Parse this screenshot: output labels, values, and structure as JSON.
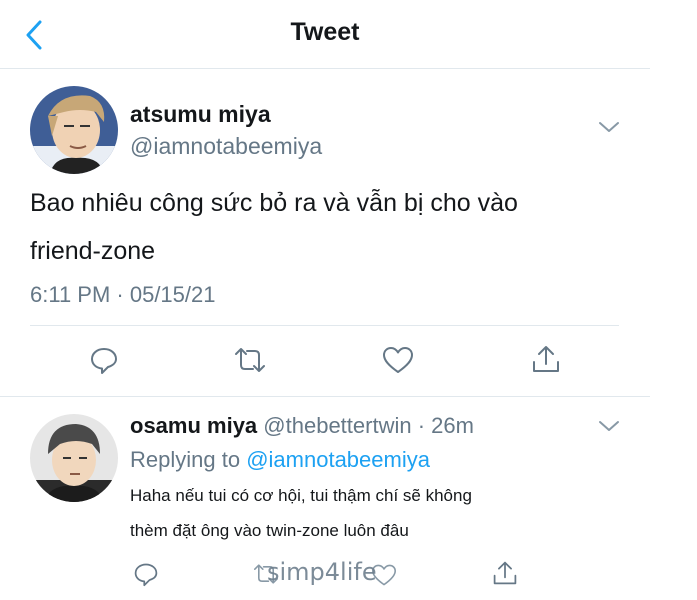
{
  "header": {
    "title": "Tweet"
  },
  "tweet": {
    "author_name": "atsumu miya",
    "author_handle": "@iamnotabeemiya",
    "text_line1": "Bao nhiêu công sức bỏ ra và vẫn bị cho vào",
    "text_line2": "friend-zone",
    "timestamp": "6:11 PM · 05/15/21"
  },
  "reply": {
    "author_name": "osamu miya",
    "author_handle": "@thebettertwin",
    "age": "· 26m",
    "replying_to_label": "Replying to",
    "replying_to_handle": "@iamnotabeemiya",
    "text_line1": "Haha nếu tui có cơ hội, tui thậm chí sẽ không",
    "text_line2": "thèm đặt ông vào twin-zone luôn đâu"
  },
  "watermark": "simp4life",
  "icons": {
    "back": "chevron-left-icon",
    "more": "chevron-down-icon",
    "reply": "reply-icon",
    "retweet": "retweet-icon",
    "like": "heart-icon",
    "share": "share-icon"
  },
  "colors": {
    "accent": "#1da1f2",
    "text": "#14171a",
    "muted": "#657786",
    "divider": "#e1e8ed"
  }
}
